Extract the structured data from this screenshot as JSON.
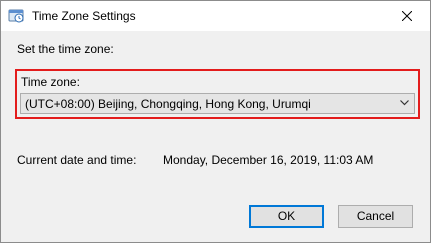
{
  "window": {
    "title": "Time Zone Settings",
    "icon": "time-zone-settings-icon",
    "close_icon": "close-icon"
  },
  "content": {
    "instruction": "Set the time zone:",
    "time_zone_label": "Time zone:",
    "time_zone_selected": "(UTC+08:00) Beijing, Chongqing, Hong Kong, Urumqi",
    "current_datetime_label": "Current date and time:",
    "current_datetime_value": "Monday, December 16, 2019, 11:03 AM"
  },
  "buttons": {
    "ok_label": "OK",
    "cancel_label": "Cancel"
  },
  "colors": {
    "highlight": "#e31c1c",
    "focus": "#0078d7",
    "dialog_bg": "#f0f0f0"
  }
}
